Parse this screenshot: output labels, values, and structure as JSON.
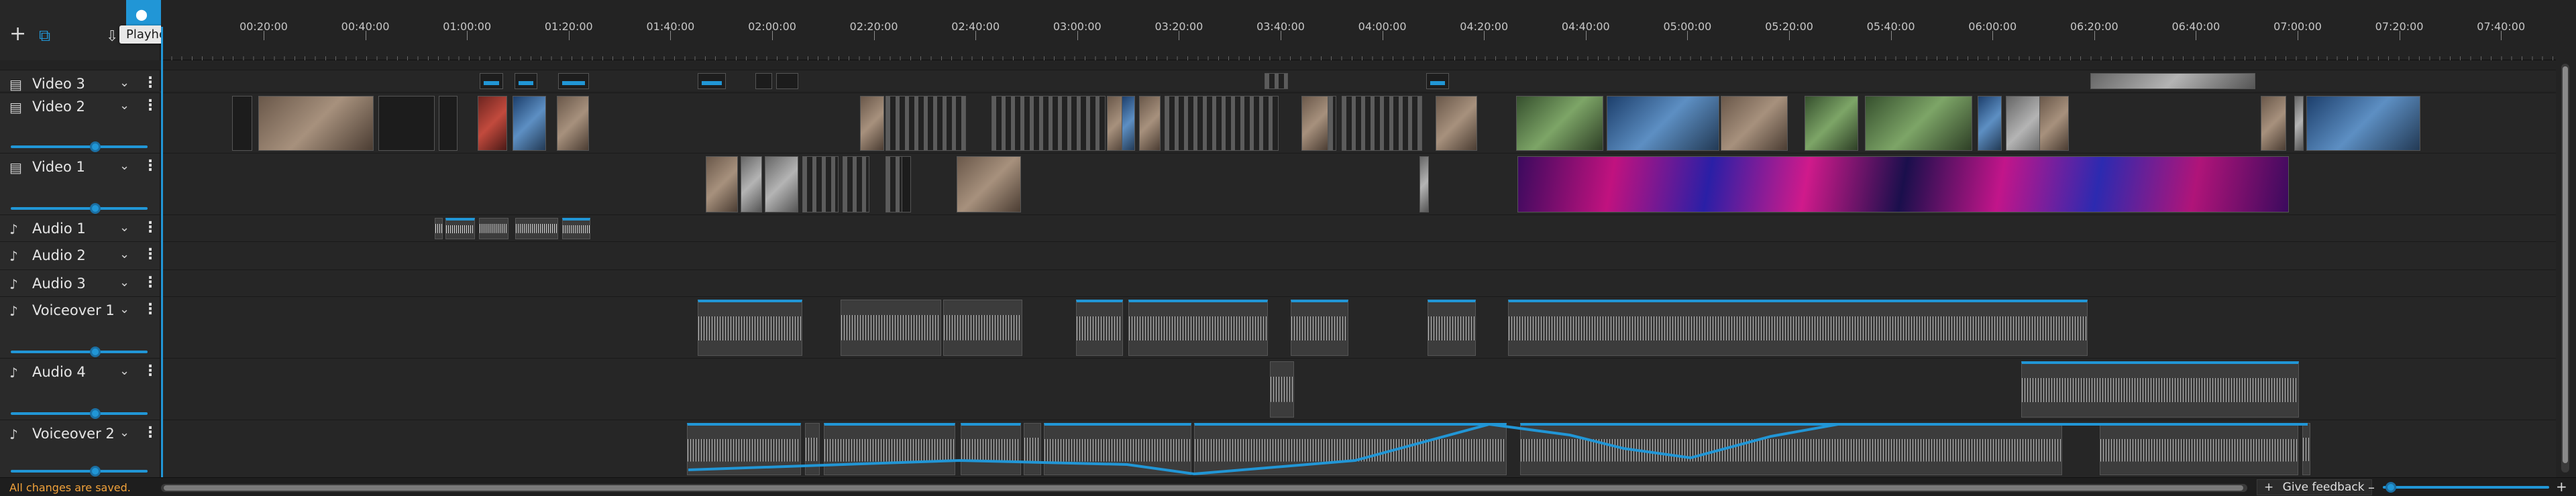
{
  "header": {
    "add_icon": "plus-icon",
    "add_glyph": "+",
    "copy_icon": "copy-icon",
    "copy_glyph": "⧉",
    "save_icon": "save-icon",
    "save_glyph": "⇩",
    "playhead_tooltip": "Playhead",
    "marker_icon": "map-marker-icon",
    "marker_glyph": "⬤",
    "split_icon": "scissors-icon",
    "split_glyph": "✂"
  },
  "ruler": {
    "ticks": [
      "00:20:00",
      "00:40:00",
      "01:00:00",
      "01:20:00",
      "01:40:00",
      "02:00:00",
      "02:20:00",
      "02:40:00",
      "03:00:00",
      "03:20:00",
      "03:40:00",
      "04:00:00",
      "04:20:00",
      "04:40:00",
      "05:00:00",
      "05:20:00",
      "05:40:00",
      "06:00:00",
      "06:20:00",
      "06:40:00",
      "07:00:00",
      "07:20:00",
      "07:40:00"
    ]
  },
  "tracks": [
    {
      "id": "video3",
      "name": "Video 3",
      "icon": "film-icon",
      "glyph": "▤",
      "kind": "video",
      "volume": null
    },
    {
      "id": "video2",
      "name": "Video 2",
      "icon": "film-icon",
      "glyph": "▤",
      "kind": "video",
      "volume": 0.62
    },
    {
      "id": "video1",
      "name": "Video 1",
      "icon": "film-icon",
      "glyph": "▤",
      "kind": "video",
      "volume": 0.62
    },
    {
      "id": "audio1",
      "name": "Audio 1",
      "icon": "music-note-icon",
      "glyph": "♪",
      "kind": "audio",
      "volume": null
    },
    {
      "id": "audio2",
      "name": "Audio 2",
      "icon": "music-note-icon",
      "glyph": "♪",
      "kind": "audio",
      "volume": null
    },
    {
      "id": "audio3",
      "name": "Audio 3",
      "icon": "music-note-icon",
      "glyph": "♪",
      "kind": "audio",
      "volume": null
    },
    {
      "id": "voiceover1",
      "name": "Voiceover 1",
      "icon": "music-note-icon",
      "glyph": "♪",
      "kind": "audio",
      "volume": 0.62
    },
    {
      "id": "audio4",
      "name": "Audio 4",
      "icon": "music-note-icon",
      "glyph": "♪",
      "kind": "audio",
      "volume": 0.62
    },
    {
      "id": "voiceover2",
      "name": "Voiceover 2",
      "icon": "music-note-icon",
      "glyph": "♪",
      "kind": "audio",
      "volume": 0.62
    }
  ],
  "track_menu": {
    "caret_glyph": "⌄",
    "kebab_glyph": "⋮"
  },
  "status": {
    "message": "All changes are saved."
  },
  "footer": {
    "feedback_label": "Give feedback",
    "feedback_glyph": "+",
    "zoom_minus": "–",
    "zoom_plus": "+",
    "zoom_level": 0.02
  },
  "colors": {
    "accent": "#2196d6",
    "status": "#f2a23a"
  }
}
